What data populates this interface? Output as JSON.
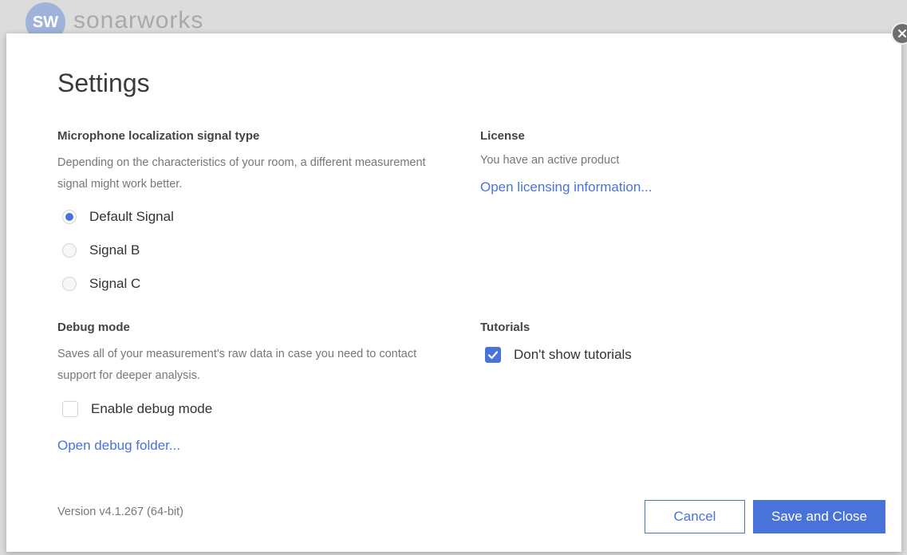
{
  "app": {
    "logo_mark": "SW",
    "logo_text": "sonarworks"
  },
  "dialog": {
    "title": "Settings",
    "close_icon": "close-icon"
  },
  "signal": {
    "heading": "Microphone localization signal type",
    "description": "Depending on the characteristics of your room, a different measurement signal might work better.",
    "options": [
      {
        "label": "Default Signal",
        "selected": true
      },
      {
        "label": "Signal B",
        "selected": false
      },
      {
        "label": "Signal C",
        "selected": false
      }
    ]
  },
  "license": {
    "heading": "License",
    "status": "You have an active product",
    "link": "Open licensing information..."
  },
  "debug": {
    "heading": "Debug mode",
    "description": "Saves all of your measurement's raw data in case you need to contact support for deeper analysis.",
    "checkbox_label": "Enable debug mode",
    "checked": false,
    "link": "Open debug folder..."
  },
  "tutorials": {
    "heading": "Tutorials",
    "checkbox_label": "Don't show tutorials",
    "checked": true
  },
  "footer": {
    "version": "Version v4.1.267 (64-bit)",
    "cancel_label": "Cancel",
    "save_label": "Save and Close"
  },
  "colors": {
    "accent": "#4a73d9",
    "close_button": "#6e6e6e"
  }
}
